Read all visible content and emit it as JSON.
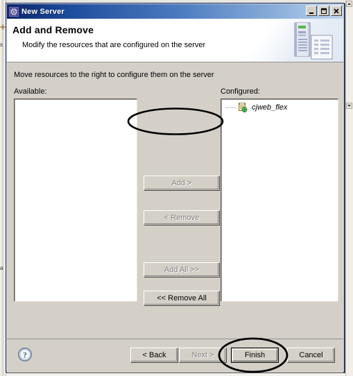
{
  "window": {
    "title": "New Server",
    "title_icon": "server-gear-icon",
    "controls": {
      "minimize_label": "_",
      "maximize_label": "□",
      "close_label": "✕"
    }
  },
  "header": {
    "title": "Add and Remove",
    "description": "Modify the resources that are configured on the server",
    "icon": "server-and-document-icon"
  },
  "main": {
    "instruction": "Move resources to the right to configure them on the server",
    "available": {
      "label": "Available:",
      "items": []
    },
    "configured": {
      "label": "Configured:",
      "items": [
        {
          "label": "cjweb_flex",
          "icon": "web-module-icon"
        }
      ]
    },
    "transfer_buttons": [
      {
        "label": "Add >",
        "enabled": false,
        "name": "add-button"
      },
      {
        "label": "< Remove",
        "enabled": false,
        "name": "remove-button"
      },
      {
        "label": "Add All >>",
        "enabled": false,
        "name": "add-all-button"
      },
      {
        "label": "<< Remove All",
        "enabled": true,
        "name": "remove-all-button"
      }
    ]
  },
  "footer": {
    "help_icon": "help-question-icon",
    "buttons": [
      {
        "label": "< Back",
        "enabled": true,
        "default": false
      },
      {
        "label": "Next >",
        "enabled": false,
        "default": false
      },
      {
        "label": "Finish",
        "enabled": true,
        "default": true
      },
      {
        "label": "Cancel",
        "enabled": true,
        "default": false
      }
    ]
  },
  "annotations": [
    {
      "name": "annotation-ellipse-add",
      "target": "Add >"
    },
    {
      "name": "annotation-ellipse-finish",
      "target": "Finish"
    }
  ],
  "backdrop": {
    "left_text": "s",
    "left_text2": "a"
  },
  "colors": {
    "title_bar_start": "#0a246a",
    "title_bar_end": "#c3d7ef",
    "dialog_face": "#d4d0c8",
    "disabled_text": "#868280",
    "annotation": "#000000"
  }
}
